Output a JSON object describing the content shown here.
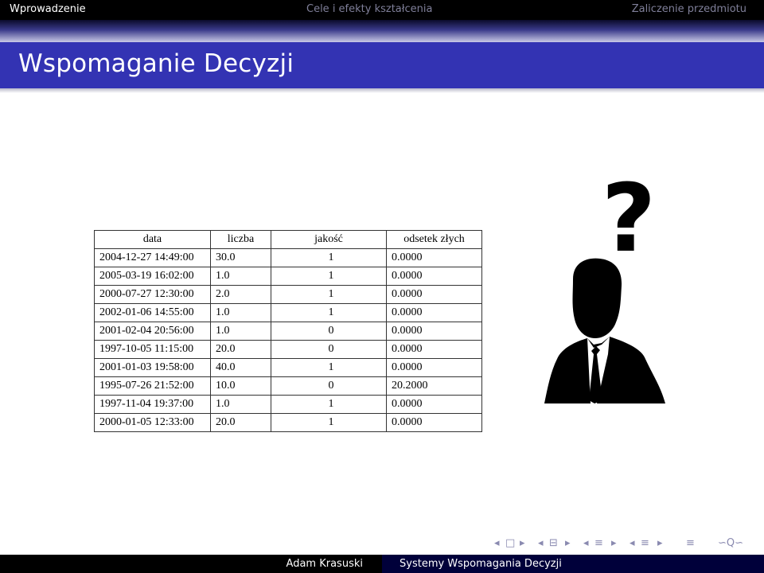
{
  "header": {
    "section_current": "Wprowadzenie",
    "section_next": "Cele i efekty kształcenia",
    "section_last": "Zaliczenie przedmiotu"
  },
  "frame": {
    "title": "Wspomaganie Decyzji"
  },
  "table": {
    "headers": [
      "data",
      "liczba",
      "jakość",
      "odsetek złych"
    ],
    "rows": [
      [
        "2004-12-27 14:49:00",
        "30.0",
        "1",
        "0.0000"
      ],
      [
        "2005-03-19 16:02:00",
        "1.0",
        "1",
        "0.0000"
      ],
      [
        "2000-07-27 12:30:00",
        "2.0",
        "1",
        "0.0000"
      ],
      [
        "2002-01-06 14:55:00",
        "1.0",
        "1",
        "0.0000"
      ],
      [
        "2001-02-04 20:56:00",
        "1.0",
        "0",
        "0.0000"
      ],
      [
        "1997-10-05 11:15:00",
        "20.0",
        "0",
        "0.0000"
      ],
      [
        "2001-01-03 19:58:00",
        "40.0",
        "1",
        "0.0000"
      ],
      [
        "1995-07-26 21:52:00",
        "10.0",
        "0",
        "20.2000"
      ],
      [
        "1997-11-04 19:37:00",
        "1.0",
        "1",
        "0.0000"
      ],
      [
        "2000-01-05 12:33:00",
        "20.0",
        "1",
        "0.0000"
      ]
    ]
  },
  "illustration": {
    "glyph": "?",
    "icon": "thinking-businessman-icon"
  },
  "nav": {
    "prev_arrow": "◂",
    "next_arrow": "▸",
    "frame_icon": "□",
    "subsection_icon": "⊟",
    "section_icon": "≡",
    "align_icon": "≡",
    "search_icon": "∽Q∽"
  },
  "footer": {
    "author": "Adam Krasuski",
    "title": "Systemy Wspomagania Decyzji"
  },
  "colors": {
    "title_bar": "#3333b3",
    "top_bar": "#000000",
    "footer_right": "#00003a",
    "nav_inactive": "#7f7f99"
  }
}
